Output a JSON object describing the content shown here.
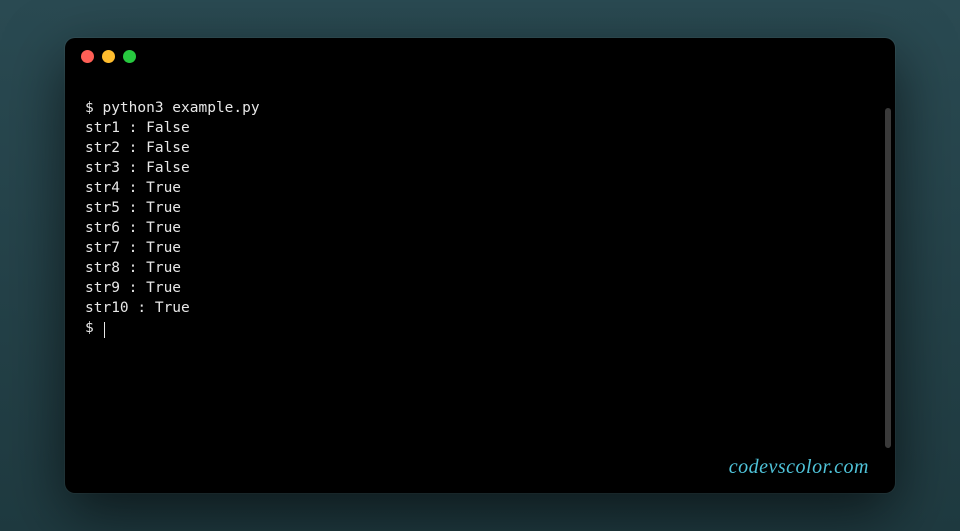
{
  "terminal": {
    "prompt": "$",
    "command": "python3 example.py",
    "lines": [
      "str1 : False",
      "str2 : False",
      "str3 : False",
      "str4 : True",
      "str5 : True",
      "str6 : True",
      "str7 : True",
      "str8 : True",
      "str9 : True",
      "str10 : True"
    ],
    "final_prompt": "$"
  },
  "watermark": "codevscolor.com",
  "colors": {
    "background": "#000000",
    "text": "#e8e8e8",
    "watermark": "#4fc3d9",
    "close": "#ff5f56",
    "minimize": "#ffbd2e",
    "maximize": "#27c93f"
  }
}
